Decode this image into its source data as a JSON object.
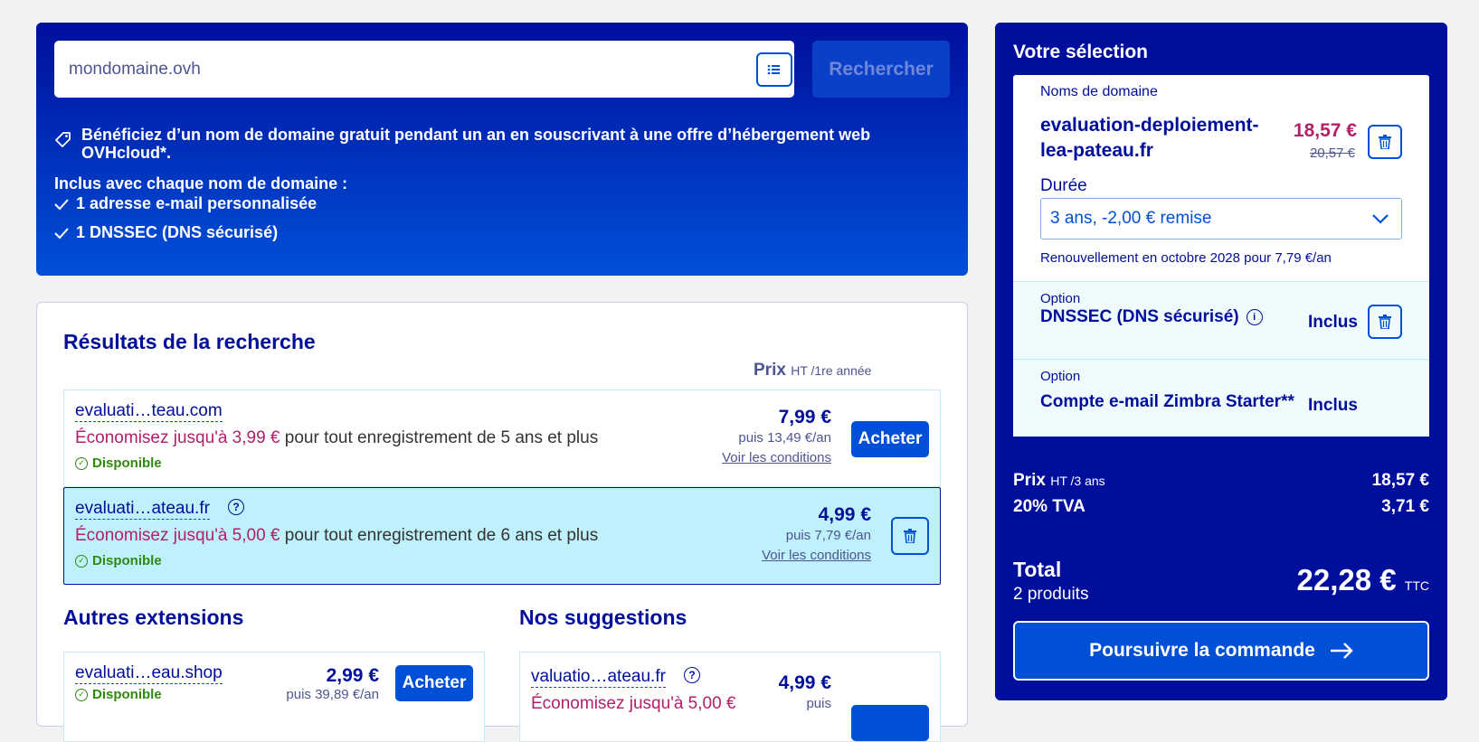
{
  "search": {
    "value": "mondomaine.ovh",
    "button": "Rechercher"
  },
  "hero": {
    "promo": "Bénéficiez d’un nom de domaine gratuit pendant un an en souscrivant à une offre d’hébergement web OVHcloud*.",
    "included_title": "Inclus avec chaque nom de domaine :",
    "included_items": [
      "1 adresse e-mail personnalisée",
      "1 DNSSEC (DNS sécurisé)"
    ]
  },
  "results": {
    "title": "Résultats de la recherche",
    "price_header": "Prix",
    "price_header_sub": "HT /1re année",
    "rows": [
      {
        "domain": "evaluati…teau.com",
        "savings_strong": "Économisez jusqu'à 3,99 €",
        "savings_rest": " pour tout enregistrement de 5 ans et plus",
        "status": "Disponible",
        "price": "7,99 €",
        "renew": "puis 13,49 €/an",
        "conditions": "Voir les conditions",
        "action": "Acheter"
      },
      {
        "domain": "evaluati…ateau.fr",
        "savings_strong": "Économisez jusqu'à 5,00 €",
        "savings_rest": " pour tout enregistrement de 6 ans et plus",
        "status": "Disponible",
        "price": "4,99 €",
        "renew": "puis 7,79 €/an",
        "conditions": "Voir les conditions"
      }
    ],
    "other_extensions_title": "Autres extensions",
    "other_extensions": [
      {
        "domain": "evaluati…eau.shop",
        "status": "Disponible",
        "price": "2,99 €",
        "renew": "puis 39,89 €/an",
        "action": "Acheter"
      }
    ],
    "suggestions_title": "Nos suggestions",
    "suggestions": [
      {
        "domain": "valuatio…ateau.fr",
        "savings_strong": "Économisez jusqu'à 5,00 €",
        "price": "4,99 €",
        "renew": "puis"
      }
    ]
  },
  "selection": {
    "title": "Votre sélection",
    "domain_label": "Noms de domaine",
    "domain_line1": "evaluation-deploiement-",
    "domain_line2": "lea-pateau.fr",
    "price": "18,57 €",
    "old_price": "20,57 €",
    "duration_label": "Durée",
    "duration_value": "3 ans, -2,00 € remise",
    "renewal": "Renouvellement en octobre 2028 pour 7,79 €/an",
    "options": [
      {
        "label": "Option",
        "name": "DNSSEC (DNS sécurisé)",
        "status": "Inclus"
      },
      {
        "label": "Option",
        "name": "Compte e-mail Zimbra Starter**",
        "status": "Inclus"
      }
    ],
    "price_label": "Prix",
    "price_label_sub": "HT /3 ans",
    "price_value": "18,57 €",
    "vat_label": "20% TVA",
    "vat_value": "3,71 €",
    "total_label": "Total",
    "total_count": "2 produits",
    "total_value": "22,28 €",
    "total_suffix": "TTC",
    "continue": "Poursuivre la commande"
  },
  "colors": {
    "brand_dark": "#000e9c",
    "brand": "#0050d7",
    "promo_pink": "#b2206a",
    "available_green": "#2f8a0e",
    "selected_row": "#bef1fc"
  },
  "icons": [
    "list-icon",
    "tag-icon",
    "check-icon",
    "check-circle-icon",
    "help-icon",
    "trash-icon",
    "chevron-down-icon",
    "info-icon",
    "arrow-right-icon"
  ]
}
